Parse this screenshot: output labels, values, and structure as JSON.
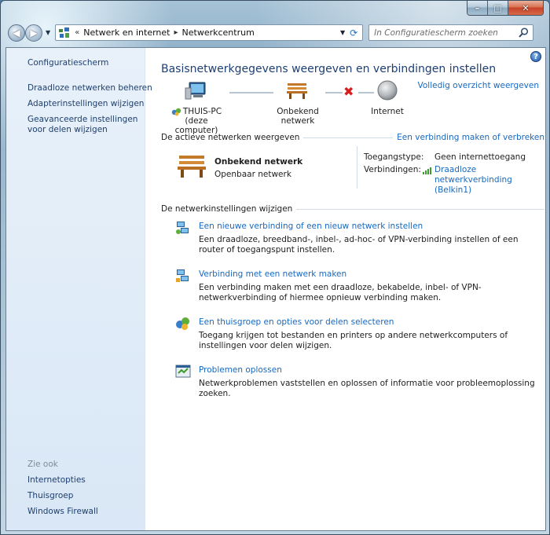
{
  "window": {
    "caption": {
      "minimize": "–",
      "maximize": "□",
      "close": "✕"
    }
  },
  "nav": {
    "breadcrumb_lead": "«",
    "breadcrumbs": [
      "Netwerk en internet",
      "Netwerkcentrum"
    ],
    "search_placeholder": "In Configuratiescherm zoeken"
  },
  "sidebar": {
    "home": "Configuratiescherm",
    "links": [
      "Draadloze netwerken beheren",
      "Adapterinstellingen wijzigen",
      "Geavanceerde instellingen voor delen wijzigen"
    ],
    "see_also_heading": "Zie ook",
    "see_also": [
      "Internetopties",
      "Thuisgroep",
      "Windows Firewall"
    ]
  },
  "main": {
    "title": "Basisnetwerkgegevens weergeven en verbindingen instellen",
    "full_map_link": "Volledig overzicht weergeven",
    "map": {
      "computer_name": "THUIS-PC",
      "computer_sub": "(deze computer)",
      "network_name": "Onbekend netwerk",
      "internet": "Internet"
    },
    "active_networks": {
      "heading": "De actieve netwerken weergeven",
      "connect_link": "Een verbinding maken of verbreken",
      "network_name": "Onbekend netwerk",
      "network_type": "Openbaar netwerk",
      "access_type_label": "Toegangstype:",
      "access_type_value": "Geen internettoegang",
      "connections_label": "Verbindingen:",
      "connection_value": "Draadloze netwerkverbinding (Belkin1)"
    },
    "change_settings": {
      "heading": "De netwerkinstellingen wijzigen",
      "tasks": [
        {
          "title": "Een nieuwe verbinding of een nieuw netwerk instellen",
          "desc": "Een draadloze, breedband-, inbel-, ad-hoc- of VPN-verbinding instellen of een router of toegangspunt instellen."
        },
        {
          "title": "Verbinding met een netwerk maken",
          "desc": "Een verbinding maken met een draadloze, bekabelde, inbel- of VPN-netwerkverbinding of hiermee opnieuw verbinding maken."
        },
        {
          "title": "Een thuisgroep en opties voor delen selecteren",
          "desc": "Toegang krijgen tot bestanden en printers op andere netwerkcomputers of instellingen voor delen wijzigen."
        },
        {
          "title": "Problemen oplossen",
          "desc": "Netwerkproblemen vaststellen en oplossen of informatie voor probleemoplossing zoeken."
        }
      ]
    }
  },
  "colors": {
    "link": "#1669c2",
    "title": "#1e3f73",
    "sidebar_bg": "#e3edf8",
    "error_x": "#d61e1e"
  },
  "icons": [
    "back-arrow-icon",
    "forward-arrow-icon",
    "control-panel-icon",
    "refresh-icon",
    "search-icon",
    "help-icon",
    "computer-icon",
    "bench-icon",
    "globe-icon",
    "homegroup-icon",
    "wifi-signal-icon",
    "network-setup-icon",
    "troubleshoot-icon"
  ]
}
